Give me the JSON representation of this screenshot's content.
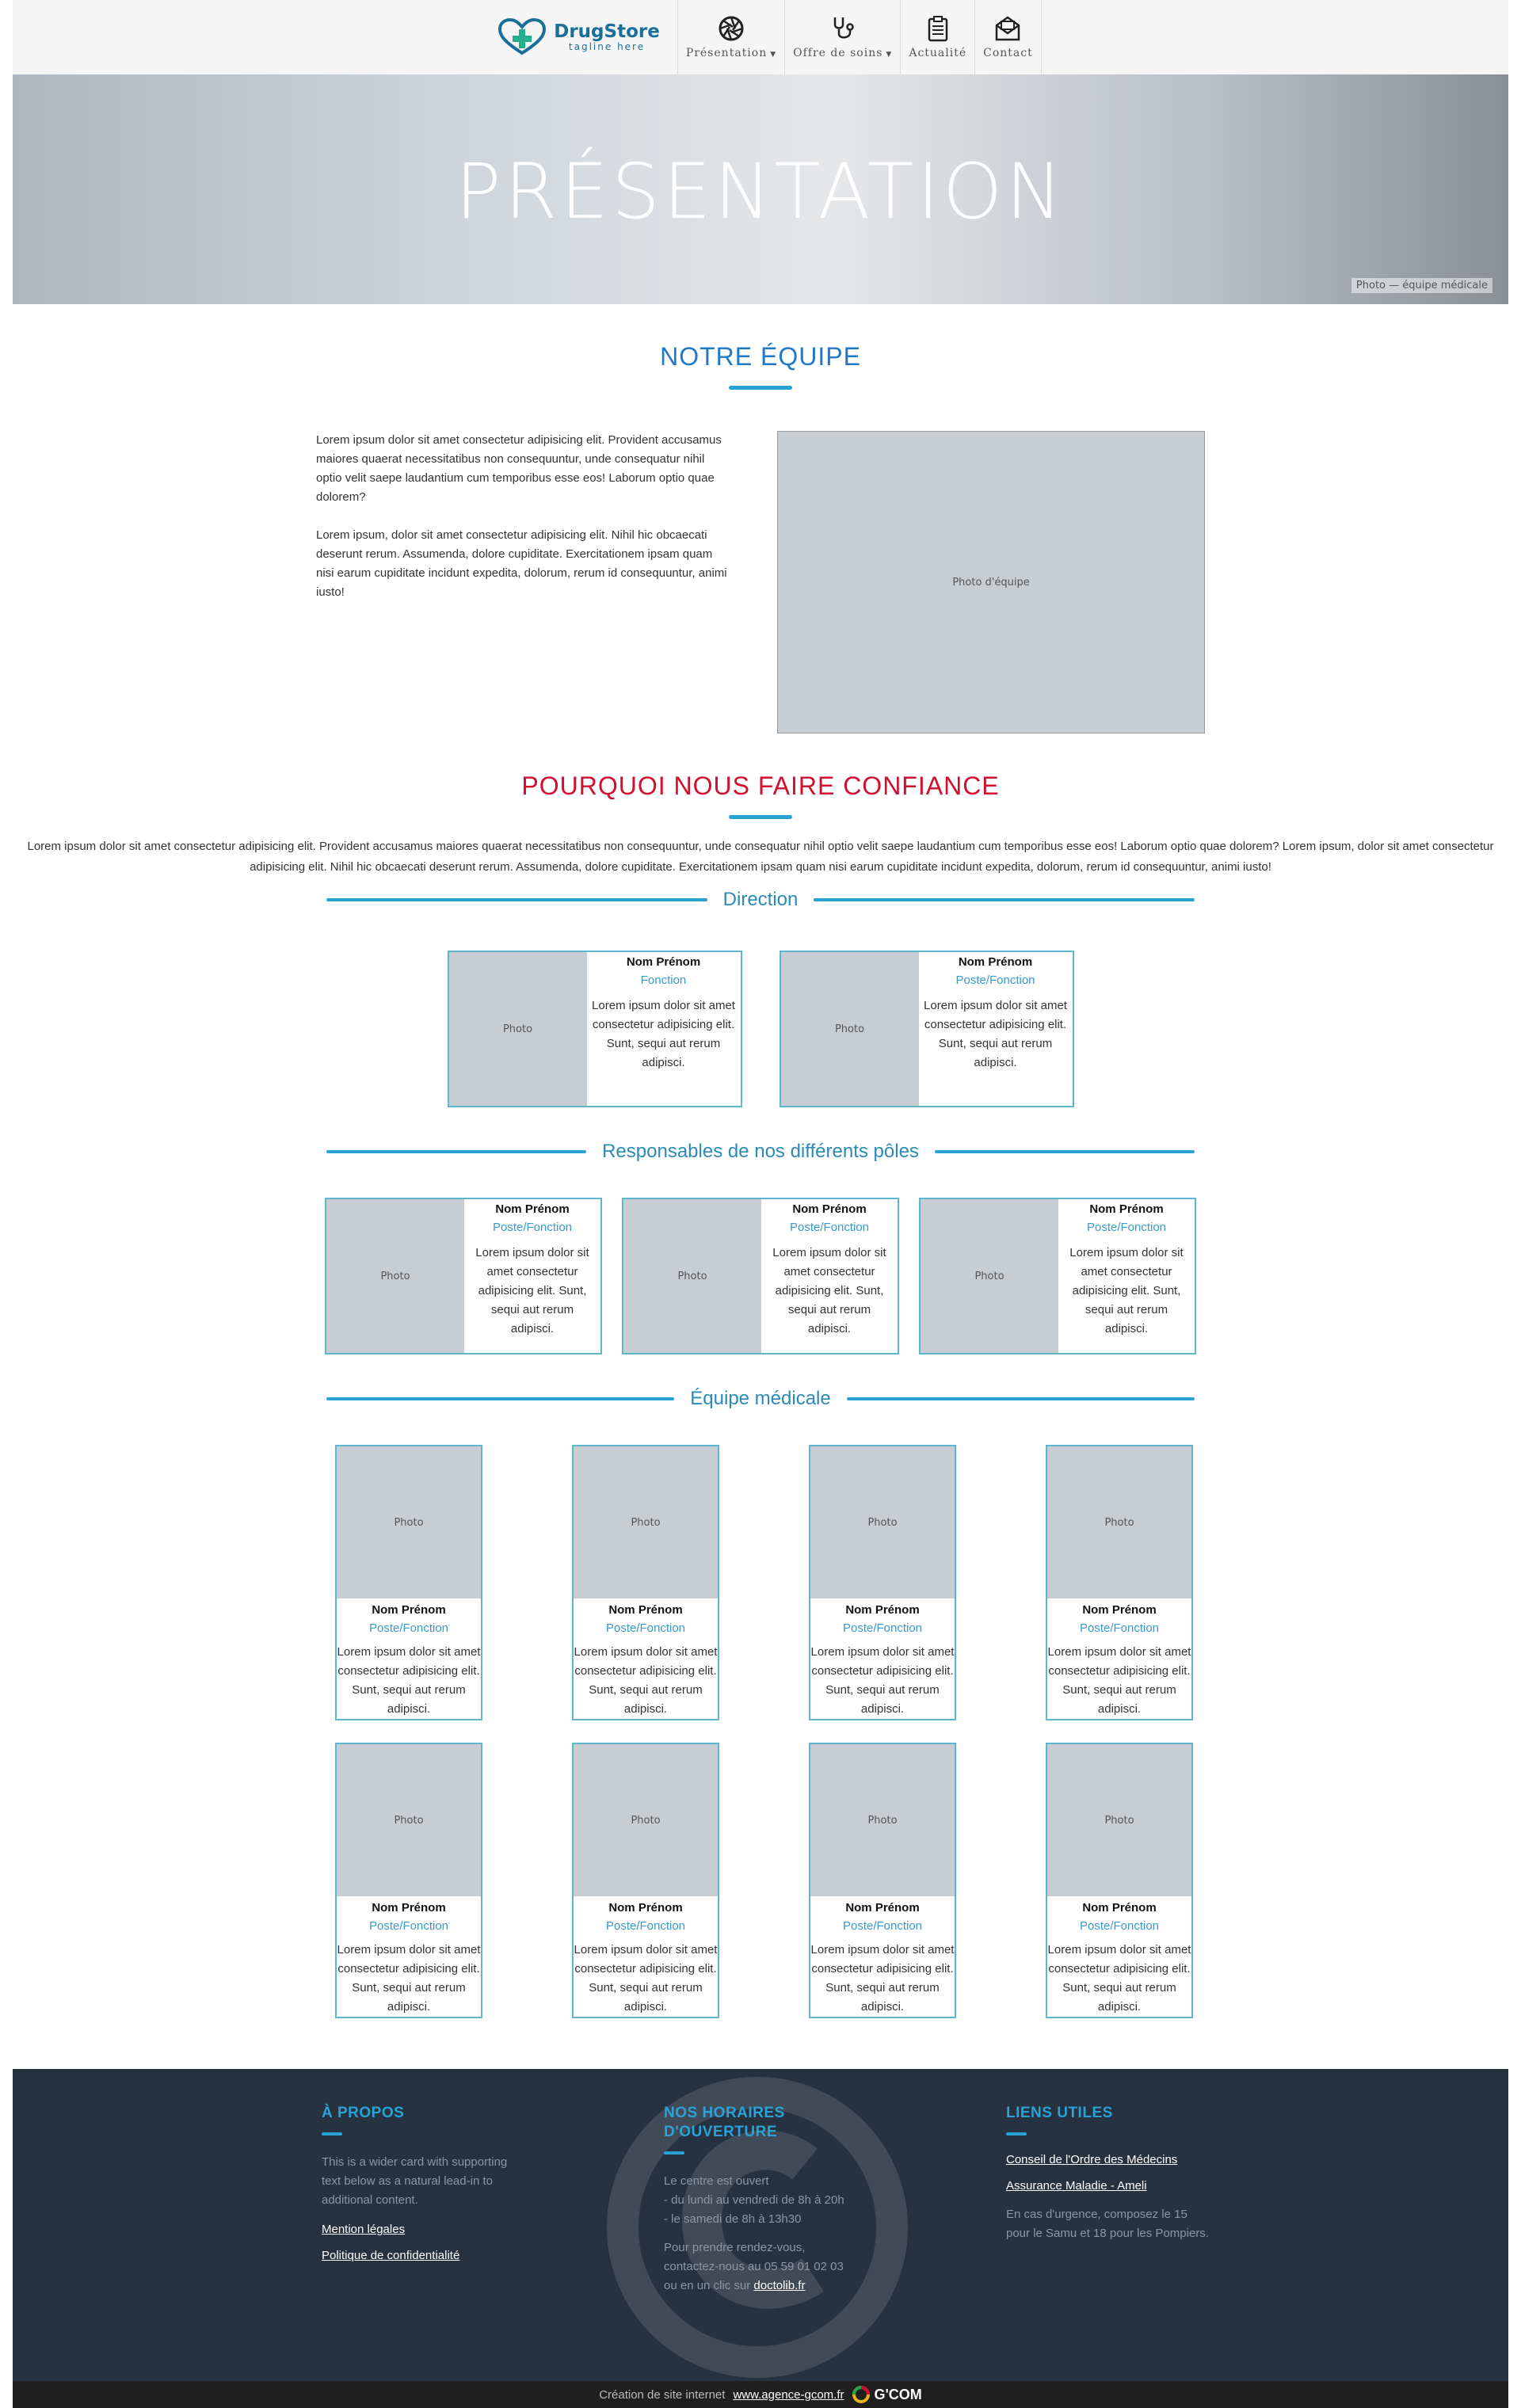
{
  "header": {
    "logo_name": "DrugStore",
    "logo_tagline": "tagline here",
    "nav": [
      {
        "label": "Présentation",
        "icon": "aperture-icon",
        "has_dropdown": true
      },
      {
        "label": "Offre de soins",
        "icon": "stethoscope-icon",
        "has_dropdown": true
      },
      {
        "label": "Actualité",
        "icon": "clipboard-icon",
        "has_dropdown": false
      },
      {
        "label": "Contact",
        "icon": "mail-icon",
        "has_dropdown": false
      }
    ]
  },
  "banner": {
    "title": "PRÉSENTATION"
  },
  "team": {
    "heading": "NOTRE ÉQUIPE",
    "paragraph1": "Lorem ipsum dolor sit amet consectetur adipisicing elit. Provident accusamus maiores quaerat necessitatibus non consequuntur, unde consequatur nihil optio velit saepe laudantium cum temporibus esse eos! Laborum optio quae dolorem?",
    "paragraph2": "Lorem ipsum, dolor sit amet consectetur adipisicing elit. Nihil hic obcaecati deserunt rerum. Assumenda, dolore cupiditate. Exercitationem ipsam quam nisi earum cupiditate incidunt expedita, dolorum, rerum id consequuntur, animi iusto!"
  },
  "trust": {
    "heading": "POURQUOI NOUS FAIRE CONFIANCE",
    "text": "Lorem ipsum dolor sit amet consectetur adipisicing elit. Provident accusamus maiores quaerat necessitatibus non consequuntur, unde consequatur nihil optio velit saepe laudantium cum temporibus esse eos! Laborum optio quae dolorem? Lorem ipsum, dolor sit amet consectetur adipisicing elit. Nihil hic obcaecati deserunt rerum. Assumenda, dolore cupiditate. Exercitationem ipsam quam nisi earum cupiditate incidunt expedita, dolorum, rerum id consequuntur, animi iusto!"
  },
  "direction": {
    "title": "Direction",
    "cards": [
      {
        "name": "Nom Prénom",
        "role": "Fonction",
        "desc": "Lorem ipsum dolor sit amet consectetur adipisicing elit. Sunt, sequi aut rerum adipisci."
      },
      {
        "name": "Nom Prénom",
        "role": "Poste/Fonction",
        "desc": "Lorem ipsum dolor sit amet consectetur adipisicing elit. Sunt, sequi aut rerum adipisci."
      }
    ]
  },
  "poles": {
    "title": "Responsables de nos différents pôles",
    "cards": [
      {
        "name": "Nom Prénom",
        "role": "Poste/Fonction",
        "desc": "Lorem ipsum dolor sit amet consectetur adipisicing elit. Sunt, sequi aut rerum adipisci."
      },
      {
        "name": "Nom Prénom",
        "role": "Poste/Fonction",
        "desc": "Lorem ipsum dolor sit amet consectetur adipisicing elit. Sunt, sequi aut rerum adipisci."
      },
      {
        "name": "Nom Prénom",
        "role": "Poste/Fonction",
        "desc": "Lorem ipsum dolor sit amet consectetur adipisicing elit. Sunt, sequi aut rerum adipisci."
      }
    ]
  },
  "medical": {
    "title": "Équipe médicale",
    "cards": [
      {
        "name": "Nom Prénom",
        "role": "Poste/Fonction",
        "desc": "Lorem ipsum dolor sit amet consectetur adipisicing elit. Sunt, sequi aut rerum adipisci."
      },
      {
        "name": "Nom Prénom",
        "role": "Poste/Fonction",
        "desc": "Lorem ipsum dolor sit amet consectetur adipisicing elit. Sunt, sequi aut rerum adipisci."
      },
      {
        "name": "Nom Prénom",
        "role": "Poste/Fonction",
        "desc": "Lorem ipsum dolor sit amet consectetur adipisicing elit. Sunt, sequi aut rerum adipisci."
      },
      {
        "name": "Nom Prénom",
        "role": "Poste/Fonction",
        "desc": "Lorem ipsum dolor sit amet consectetur adipisicing elit. Sunt, sequi aut rerum adipisci."
      },
      {
        "name": "Nom Prénom",
        "role": "Poste/Fonction",
        "desc": "Lorem ipsum dolor sit amet consectetur adipisicing elit. Sunt, sequi aut rerum adipisci."
      },
      {
        "name": "Nom Prénom",
        "role": "Poste/Fonction",
        "desc": "Lorem ipsum dolor sit amet consectetur adipisicing elit. Sunt, sequi aut rerum adipisci."
      },
      {
        "name": "Nom Prénom",
        "role": "Poste/Fonction",
        "desc": "Lorem ipsum dolor sit amet consectetur adipisicing elit. Sunt, sequi aut rerum adipisci."
      },
      {
        "name": "Nom Prénom",
        "role": "Poste/Fonction",
        "desc": "Lorem ipsum dolor sit amet consectetur adipisicing elit. Sunt, sequi aut rerum adipisci."
      }
    ]
  },
  "footer": {
    "about": {
      "title": "À PROPOS",
      "text": "This is a wider card with supporting text below as a natural lead-in to additional content.",
      "link1": "Mention légales",
      "link2": "Politique de confidentialité"
    },
    "hours": {
      "title_line1": "NOS HORAIRES",
      "title_line2": "D'OUVERTURE",
      "line1": "Le centre est ouvert",
      "line2": "- du lundi au vendredi de 8h à 20h",
      "line3": "- le samedi de 8h à 13h30",
      "rdv1": "Pour prendre rendez-vous,",
      "rdv2": "contactez-nous au 05 59 01 02 03",
      "rdv3": "ou en un clic sur",
      "rdv_link": "doctolib.fr"
    },
    "links": {
      "title": "LIENS UTILES",
      "link1": "Conseil de l'Ordre des Médecins",
      "link2": "Assurance Maladie - Ameli",
      "text": "En cas d'urgence, composez le 15 pour le Samu et 18 pour les Pompiers."
    }
  },
  "copyright": {
    "text": "Création de site internet",
    "link": "www.agence-gcom.fr",
    "brand": "G'COM"
  },
  "colors": {
    "accent": "#2aa2d6",
    "team_heading": "#1f78c8",
    "trust_heading": "#d0102e",
    "footer_bg": "#263240"
  }
}
